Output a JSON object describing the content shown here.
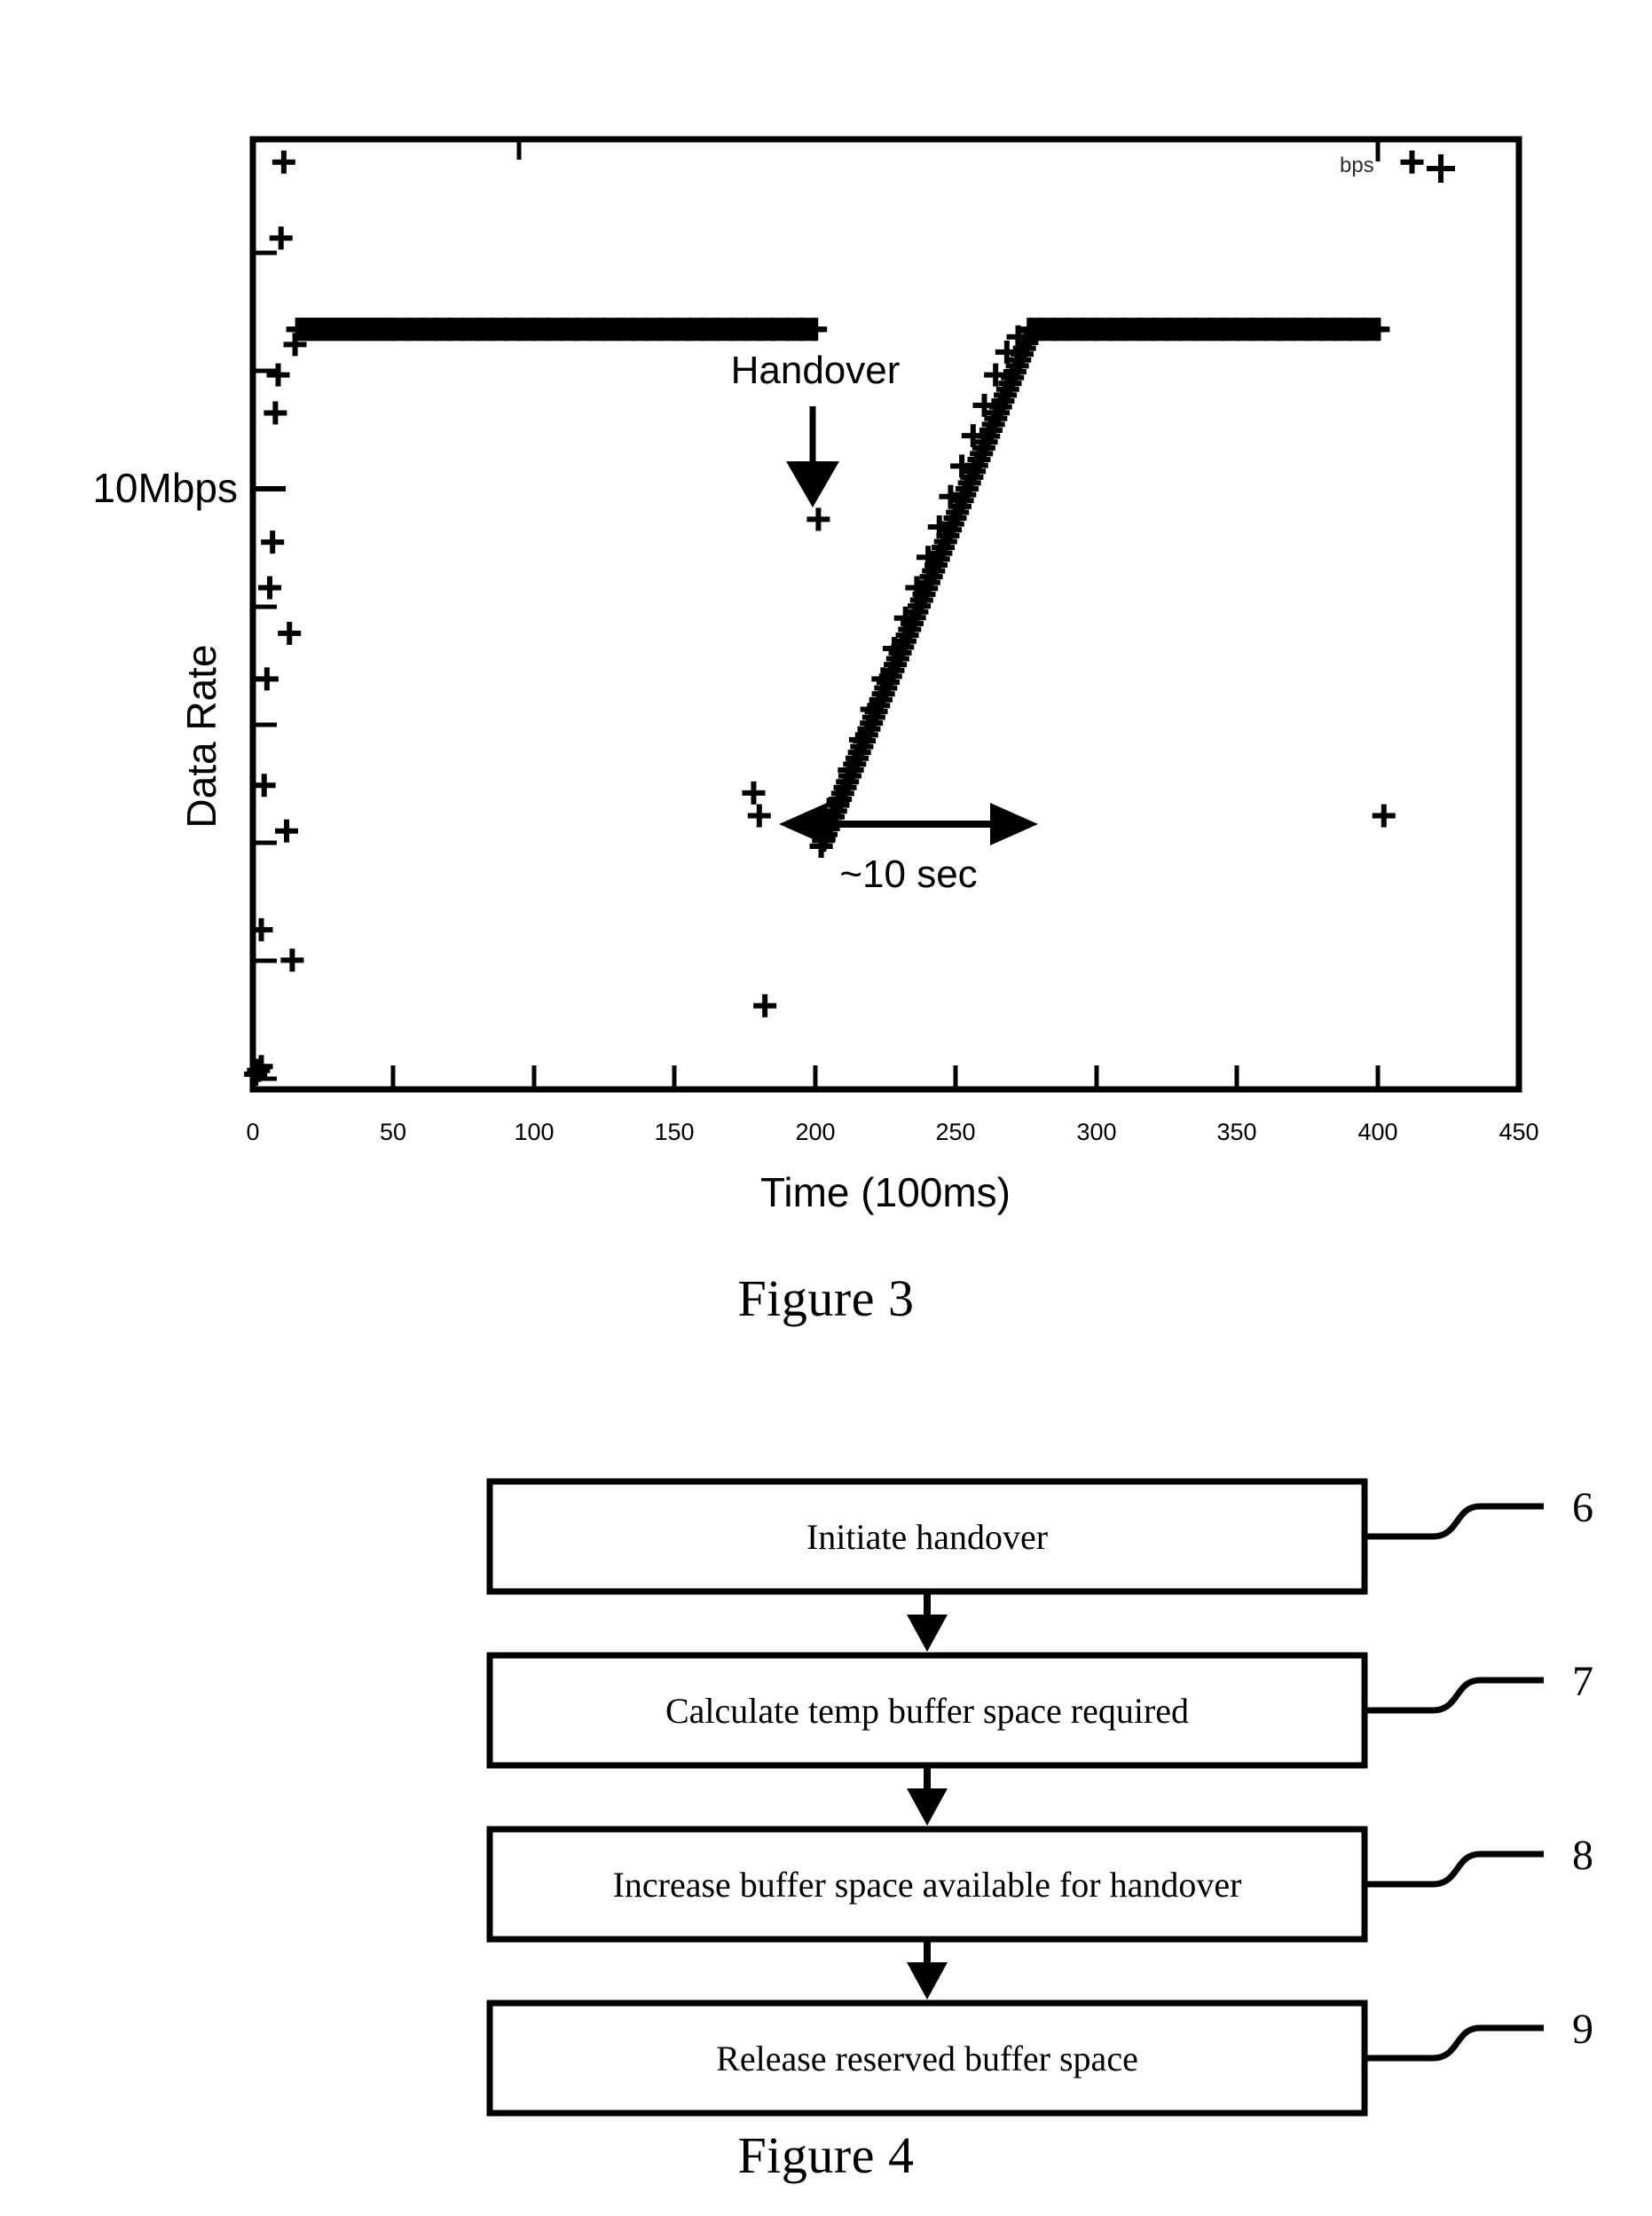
{
  "figure3": {
    "caption": "Figure 3",
    "y_axis_label": "Data Rate",
    "y_marker_label": "10Mbps",
    "x_axis_label": "Time (100ms)",
    "annotations": {
      "handover": "Handover",
      "recovery": "~10 sec"
    },
    "legend_text": "bps"
  },
  "figure4": {
    "caption": "Figure 4",
    "steps": [
      {
        "label": "Initiate handover",
        "ref": "6"
      },
      {
        "label": "Calculate temp buffer space required",
        "ref": "7"
      },
      {
        "label": "Increase buffer space available for handover",
        "ref": "8"
      },
      {
        "label": "Release reserved buffer space",
        "ref": "9"
      }
    ]
  },
  "chart_data": {
    "type": "scatter",
    "title": "",
    "xlabel": "Time (100ms)",
    "ylabel": "Data Rate",
    "xlim": [
      0,
      450
    ],
    "ylim": [
      0,
      12.5
    ],
    "grid": false,
    "legend": "bps",
    "legend_position": "top-right",
    "xticks": [
      0,
      50,
      100,
      150,
      200,
      250,
      300,
      350,
      400,
      450
    ],
    "xticklabels": [
      "0",
      "50",
      "100",
      "150",
      "200",
      "250",
      "300",
      "350",
      "400",
      "450"
    ],
    "yticks": [
      0,
      1.5,
      3.1,
      4.6,
      6.2,
      7.7,
      9.2,
      10.8
    ],
    "yticklabels": [
      "",
      "",
      "",
      "",
      "",
      "",
      "",
      ""
    ],
    "y_marker": {
      "value": 10.0,
      "label": "10Mbps"
    },
    "marker": "+",
    "marker_color": "#000000",
    "annotations": [
      {
        "text": "Handover",
        "x": 200,
        "y": 11.6,
        "arrow_to_x": 200,
        "arrow_to_y": 10.1
      },
      {
        "text": "~10 sec",
        "x": 237,
        "y": 4.1,
        "span_x": [
          200,
          277
        ],
        "style": "double-arrow"
      }
    ],
    "series": [
      {
        "name": "Data Rate (bps)",
        "comment": "Steady 10Mbps before handover at t=200, drop, then linear ramp recovery over ~10 s back to 10Mbps by t=277, then steady again.",
        "points": [
          [
            1,
            0.2
          ],
          [
            2,
            0.25
          ],
          [
            3,
            0.3
          ],
          [
            3,
            2.1
          ],
          [
            4,
            4.0
          ],
          [
            5,
            5.4
          ],
          [
            6,
            6.6
          ],
          [
            7,
            7.2
          ],
          [
            8,
            8.9
          ],
          [
            9,
            9.4
          ],
          [
            10,
            11.2
          ],
          [
            11,
            12.2
          ],
          [
            12,
            3.4
          ],
          [
            13,
            6.0
          ],
          [
            14,
            1.7
          ],
          [
            15,
            9.8
          ],
          [
            16,
            10.0
          ],
          [
            18,
            10.0
          ],
          [
            20,
            10.0
          ],
          [
            22,
            10.0
          ],
          [
            24,
            10.0
          ],
          [
            26,
            10.0
          ],
          [
            28,
            10.0
          ],
          [
            30,
            10.0
          ],
          [
            32,
            10.0
          ],
          [
            34,
            10.0
          ],
          [
            36,
            10.0
          ],
          [
            38,
            10.0
          ],
          [
            40,
            10.0
          ],
          [
            42,
            10.0
          ],
          [
            44,
            10.0
          ],
          [
            46,
            10.0
          ],
          [
            48,
            10.0
          ],
          [
            50,
            10.0
          ],
          [
            55,
            10.0
          ],
          [
            60,
            10.0
          ],
          [
            65,
            10.0
          ],
          [
            70,
            10.0
          ],
          [
            75,
            10.0
          ],
          [
            80,
            10.0
          ],
          [
            85,
            10.0
          ],
          [
            90,
            10.0
          ],
          [
            95,
            10.0
          ],
          [
            100,
            10.0
          ],
          [
            105,
            10.0
          ],
          [
            110,
            10.0
          ],
          [
            115,
            10.0
          ],
          [
            120,
            10.0
          ],
          [
            125,
            10.0
          ],
          [
            130,
            10.0
          ],
          [
            135,
            10.0
          ],
          [
            140,
            10.0
          ],
          [
            145,
            10.0
          ],
          [
            150,
            10.0
          ],
          [
            155,
            10.0
          ],
          [
            160,
            10.0
          ],
          [
            165,
            10.0
          ],
          [
            170,
            10.0
          ],
          [
            175,
            10.0
          ],
          [
            180,
            10.0
          ],
          [
            185,
            10.0
          ],
          [
            190,
            10.0
          ],
          [
            195,
            10.0
          ],
          [
            200,
            10.0
          ],
          [
            178,
            3.9
          ],
          [
            180,
            3.6
          ],
          [
            182,
            1.1
          ],
          [
            201,
            7.5
          ],
          [
            202,
            3.2
          ],
          [
            203,
            3.3
          ],
          [
            205,
            3.5
          ],
          [
            208,
            3.8
          ],
          [
            212,
            4.2
          ],
          [
            216,
            4.6
          ],
          [
            220,
            5.0
          ],
          [
            224,
            5.4
          ],
          [
            228,
            5.8
          ],
          [
            232,
            6.2
          ],
          [
            236,
            6.6
          ],
          [
            240,
            7.0
          ],
          [
            244,
            7.4
          ],
          [
            248,
            7.8
          ],
          [
            252,
            8.2
          ],
          [
            256,
            8.6
          ],
          [
            260,
            9.0
          ],
          [
            264,
            9.4
          ],
          [
            268,
            9.7
          ],
          [
            272,
            9.9
          ],
          [
            276,
            10.0
          ],
          [
            280,
            10.0
          ],
          [
            285,
            10.0
          ],
          [
            290,
            10.0
          ],
          [
            295,
            10.0
          ],
          [
            300,
            10.0
          ],
          [
            305,
            10.0
          ],
          [
            310,
            10.0
          ],
          [
            315,
            10.0
          ],
          [
            320,
            10.0
          ],
          [
            325,
            10.0
          ],
          [
            330,
            10.0
          ],
          [
            335,
            10.0
          ],
          [
            340,
            10.0
          ],
          [
            345,
            10.0
          ],
          [
            350,
            10.0
          ],
          [
            355,
            10.0
          ],
          [
            360,
            10.0
          ],
          [
            365,
            10.0
          ],
          [
            370,
            10.0
          ],
          [
            375,
            10.0
          ],
          [
            380,
            10.0
          ],
          [
            385,
            10.0
          ],
          [
            390,
            10.0
          ],
          [
            395,
            10.0
          ],
          [
            400,
            10.0
          ],
          [
            402,
            3.6
          ],
          [
            412,
            12.2
          ]
        ]
      }
    ]
  }
}
